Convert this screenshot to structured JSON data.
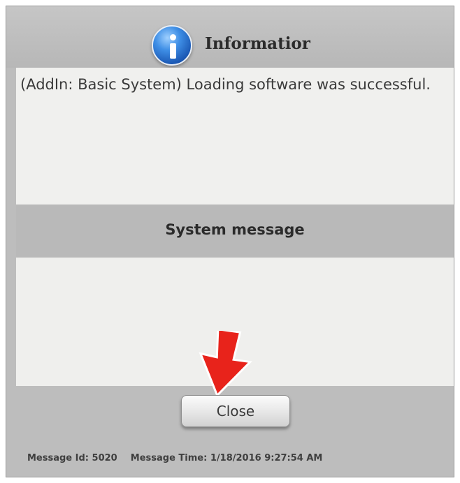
{
  "dialog": {
    "title": "Informatior",
    "title_icon": "info-icon",
    "message": "(AddIn: Basic System) Loading software was successful.",
    "system_message_title": "System message",
    "system_message_body": "",
    "close_label": "Close",
    "annotation_arrow_icon": "red-down-arrow-icon"
  },
  "footer": {
    "message_id_label": "Message Id:",
    "message_id": "5020",
    "message_time_label": "Message Time:",
    "message_time": "1/18/2016 9:27:54 AM"
  },
  "colors": {
    "frame": "#bdbdbd",
    "panel": "#f0f0ee",
    "arrow": "#e8231b",
    "info_icon": "#2a6fd0"
  }
}
